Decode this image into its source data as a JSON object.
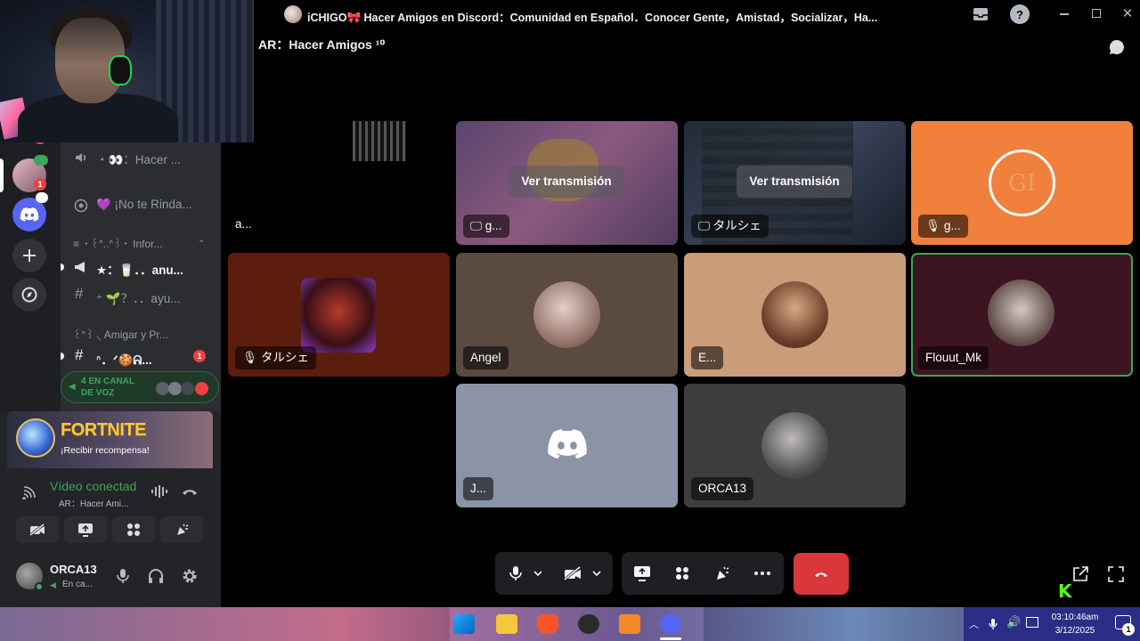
{
  "window": {
    "title": "iCHIGO🎀 Hacer Amigos en Discord：Comunidad en Español．Conocer Gente，Amistad，Socializar，Ha..."
  },
  "call": {
    "header": "AR：Hacer Amigos ¹⁰"
  },
  "channels": {
    "items": [
      {
        "label": "・👀：Hacer ..."
      },
      {
        "label": "💜 ¡No te Rinda..."
      },
      {
        "label": "≡ ・꒰ᐢ..ᐢ꒱・ Infor..."
      },
      {
        "label": "★：🥛．．anu..."
      },
      {
        "label": "⁺ 🌱？．．ayu..."
      },
      {
        "label": "꒰ᐢ꒱ ◟ Amigar y Pr..."
      },
      {
        "label": "ᐢ．ᐟ🍪ᕱ..."
      }
    ],
    "channel_badge": "1",
    "voice_pill": "4 EN CANAL DE VOZ"
  },
  "servers": {
    "badges": [
      "6",
      "1"
    ]
  },
  "promo": {
    "title": "FORTNITE",
    "subtitle": "¡Recibir recompensa!"
  },
  "connection": {
    "status": "Vídeo conectad",
    "channel": "AR：Hacer Ami..."
  },
  "user": {
    "name": "ORCA13",
    "status": "En ca..."
  },
  "tiles": [
    {
      "name": "a..."
    },
    {
      "name": "g...",
      "button": "Ver transmisión"
    },
    {
      "name": "タルシェ",
      "button": "Ver transmisión"
    },
    {
      "name": "g...",
      "avatar_text": "GI"
    },
    {
      "name": "タルシェ"
    },
    {
      "name": "Angel"
    },
    {
      "name": "E..."
    },
    {
      "name": "Flouut_Mk"
    },
    {
      "name": "J..."
    },
    {
      "name": "ORCA13"
    }
  ],
  "taskbar": {
    "time": "03:10:46am",
    "date": "3/12/2025",
    "notif_count": "1"
  },
  "colors": {
    "accent_green": "#3ba55c",
    "hangup_red": "#da373c",
    "discord_blurple": "#5865f2",
    "orange_tile": "#f0803c"
  }
}
